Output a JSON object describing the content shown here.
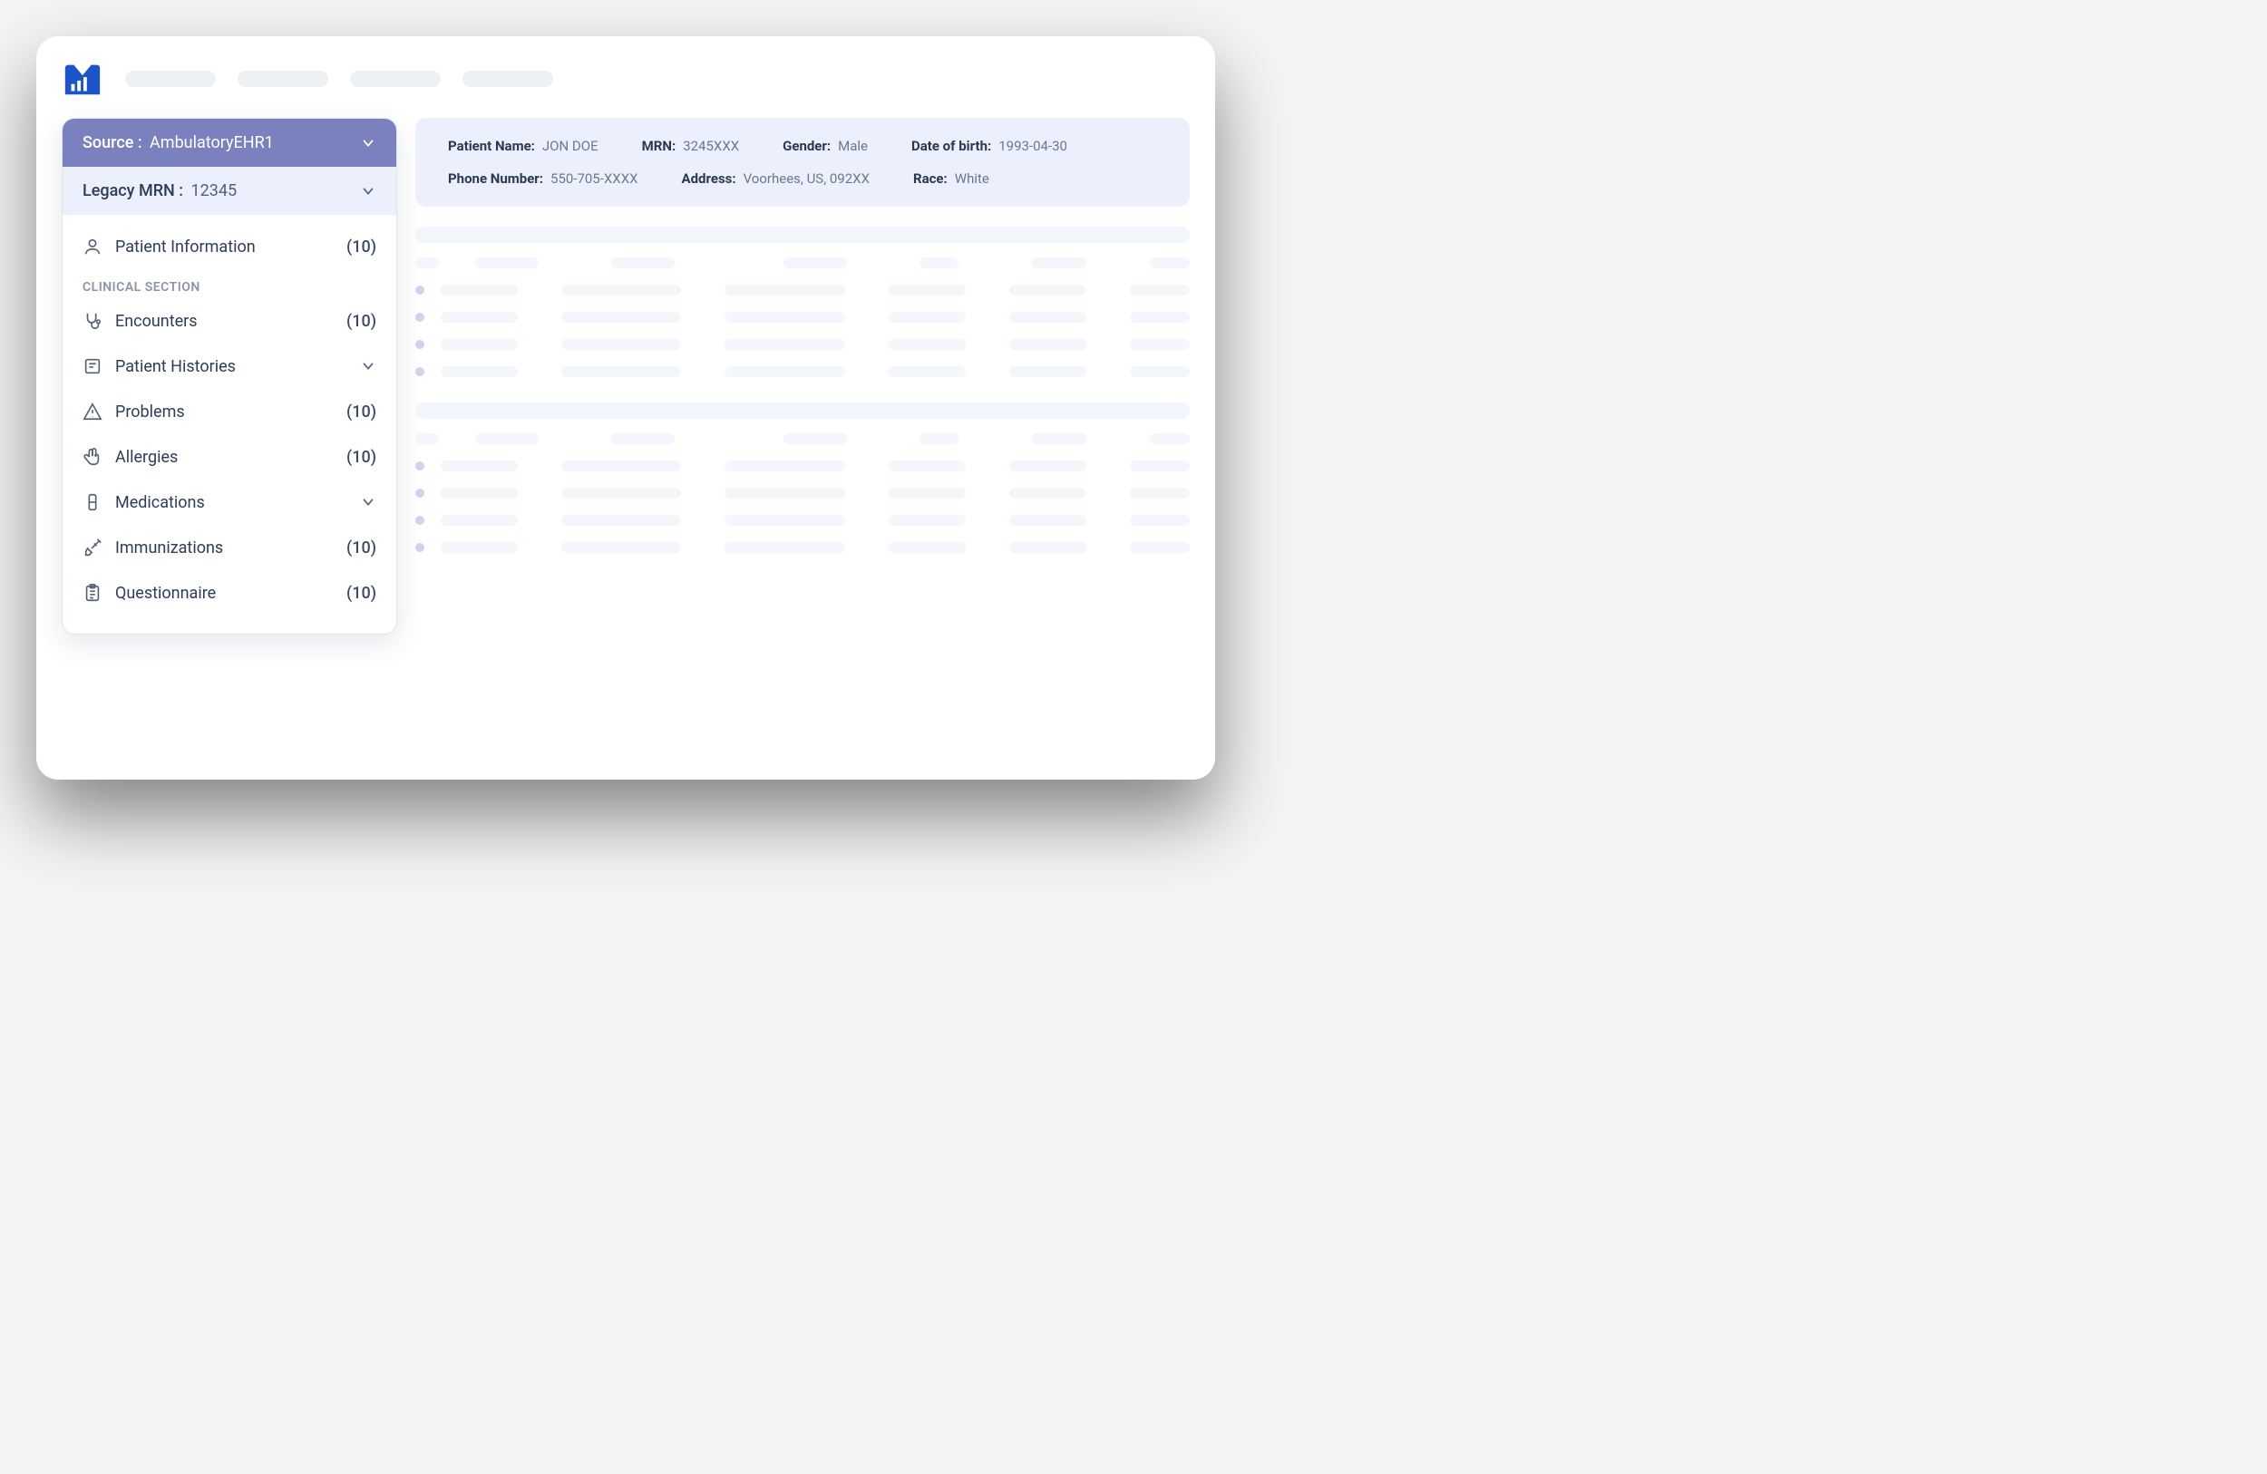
{
  "sidebar": {
    "source": {
      "label": "Source :",
      "value": "AmbulatoryEHR1"
    },
    "legacy": {
      "label": "Legacy MRN :",
      "value": "12345"
    },
    "items": [
      {
        "icon": "user-icon",
        "label": "Patient Information",
        "count": "(10)",
        "chevron": false
      }
    ],
    "clinical_heading": "CLINICAL SECTION",
    "clinical": [
      {
        "icon": "stethoscope-icon",
        "label": "Encounters",
        "count": "(10)",
        "chevron": false
      },
      {
        "icon": "history-icon",
        "label": "Patient Histories",
        "count": "",
        "chevron": true
      },
      {
        "icon": "warning-icon",
        "label": "Problems",
        "count": "(10)",
        "chevron": false
      },
      {
        "icon": "hand-icon",
        "label": "Allergies",
        "count": "(10)",
        "chevron": false
      },
      {
        "icon": "pill-icon",
        "label": "Medications",
        "count": "",
        "chevron": true
      },
      {
        "icon": "syringe-icon",
        "label": "Immunizations",
        "count": "(10)",
        "chevron": false
      },
      {
        "icon": "clipboard-icon",
        "label": "Questionnaire",
        "count": "(10)",
        "chevron": false
      }
    ]
  },
  "patient": {
    "name_label": "Patient Name:",
    "name_value": "JON DOE",
    "mrn_label": "MRN:",
    "mrn_value": "3245XXX",
    "gender_label": "Gender:",
    "gender_value": "Male",
    "dob_label": "Date of birth:",
    "dob_value": "1993-04-30",
    "phone_label": "Phone Number:",
    "phone_value": "550-705-XXXX",
    "address_label": "Address:",
    "address_value": "Voorhees, US, 092XX",
    "race_label": "Race:",
    "race_value": "White"
  },
  "colors": {
    "accent_purple": "#7b80bf",
    "panel_blue": "#ebf0fc",
    "logo_blue": "#1b55c7",
    "text_dark": "#2d3d58"
  }
}
